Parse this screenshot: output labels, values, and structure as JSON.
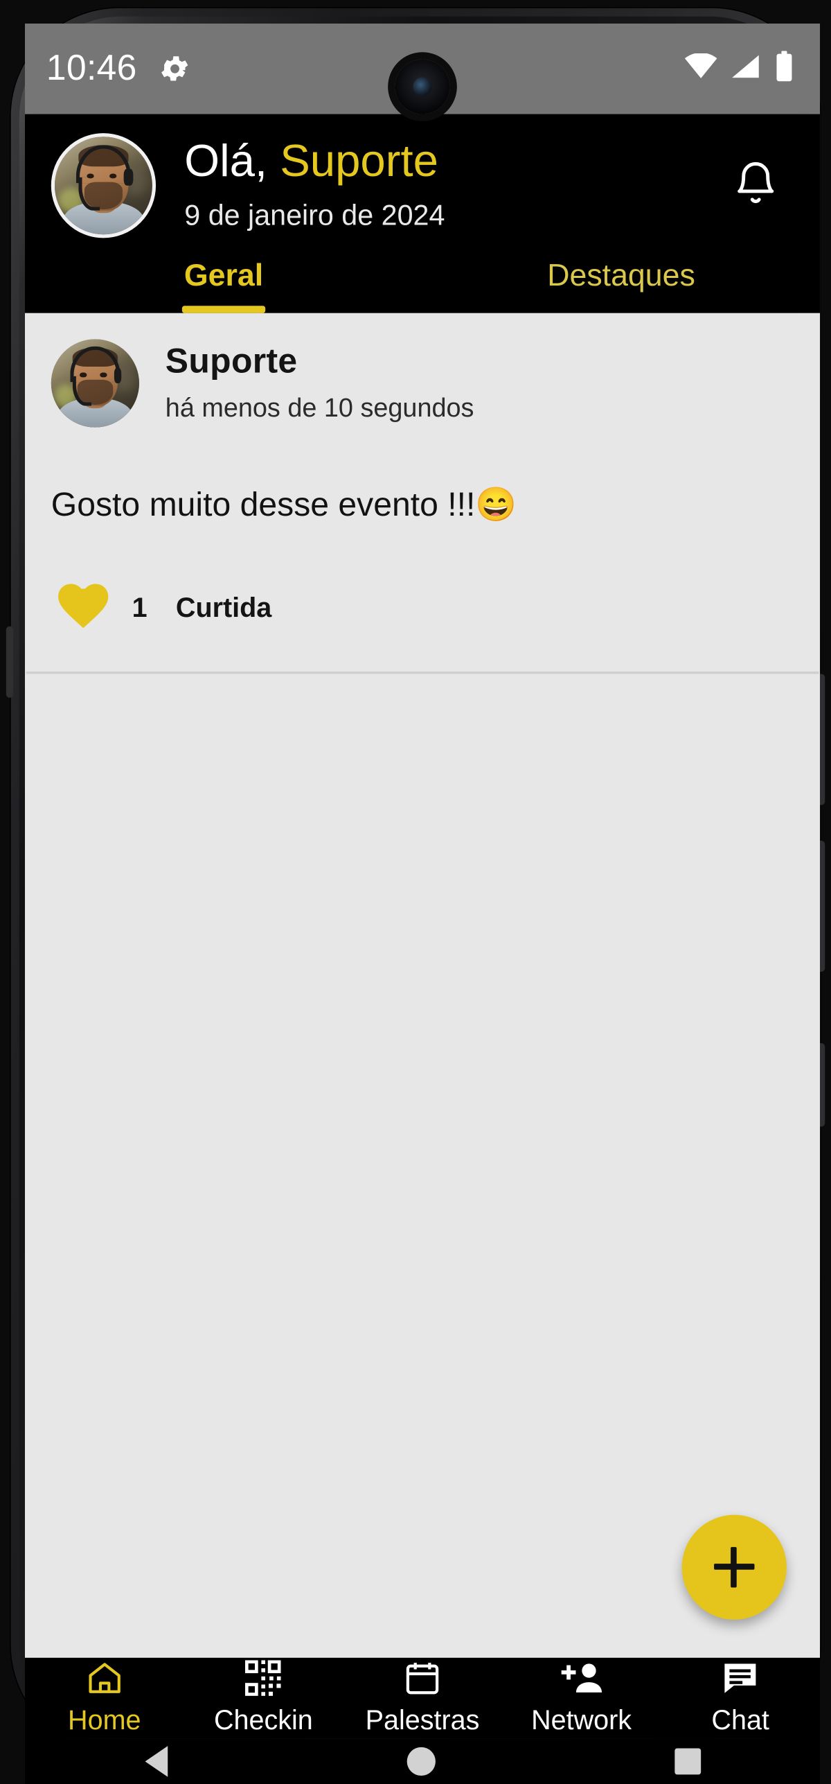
{
  "status_bar": {
    "time": "10:46",
    "icons": [
      "gear-icon",
      "wifi-icon",
      "cellular-signal-icon",
      "battery-icon"
    ],
    "background": "#767676"
  },
  "header": {
    "greeting_prefix": "Olá, ",
    "user_name": "Suporte",
    "date": "9 de janeiro de 2024",
    "avatar_name": "user-avatar",
    "notification_icon": "bell-icon",
    "accent_color": "#e5c81f",
    "background": "#000000"
  },
  "tabs": [
    {
      "label": "Geral",
      "active": true
    },
    {
      "label": "Destaques",
      "active": false
    }
  ],
  "feed": {
    "background": "#e7e7e7",
    "posts": [
      {
        "author": "Suporte",
        "timestamp": "há menos de 10 segundos",
        "text": "Gosto muito desse evento !!!😄",
        "like_icon": "heart-icon",
        "like_count": "1",
        "like_label": "Curtida"
      }
    ]
  },
  "fab": {
    "icon": "plus-icon",
    "label": "+",
    "color": "#e5c51c"
  },
  "bottom_nav": [
    {
      "label": "Home",
      "icon": "home-icon",
      "active": true
    },
    {
      "label": "Checkin",
      "icon": "qrcode-icon",
      "active": false
    },
    {
      "label": "Palestras",
      "icon": "calendar-icon",
      "active": false
    },
    {
      "label": "Network",
      "icon": "add-person-icon",
      "active": false
    },
    {
      "label": "Chat",
      "icon": "chat-icon",
      "active": false
    }
  ],
  "system_nav": [
    {
      "name": "back-button",
      "icon": "triangle-left-icon"
    },
    {
      "name": "home-button",
      "icon": "circle-icon"
    },
    {
      "name": "recents-button",
      "icon": "square-icon"
    }
  ]
}
